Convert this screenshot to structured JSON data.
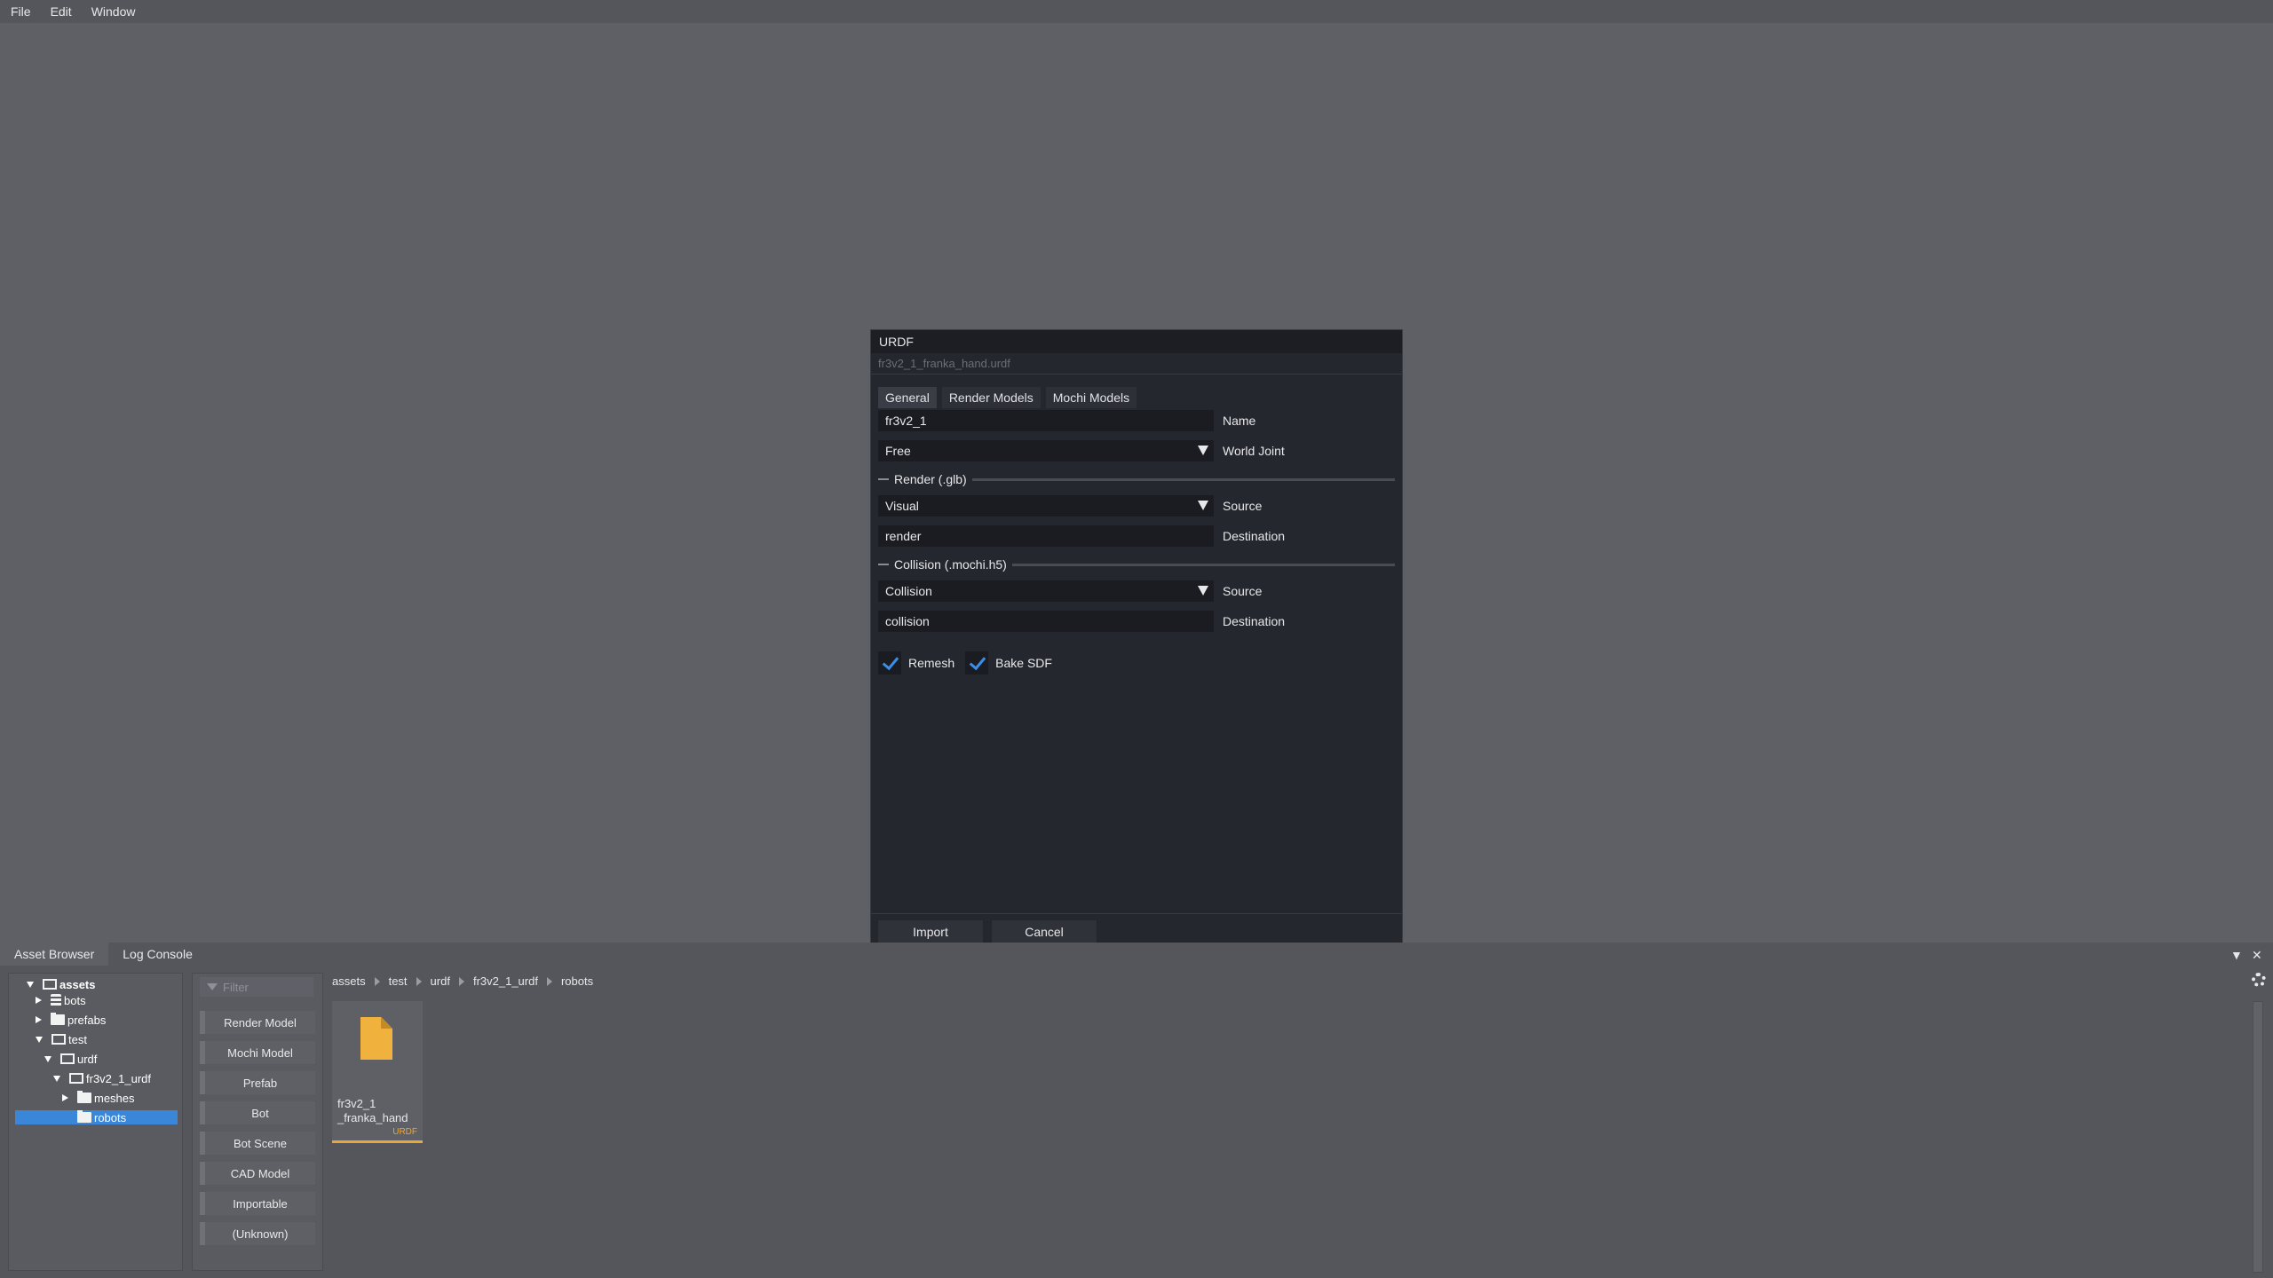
{
  "menubar": {
    "items": [
      "File",
      "Edit",
      "Window"
    ]
  },
  "dialog": {
    "title": "URDF",
    "subtitle": "fr3v2_1_franka_hand.urdf",
    "tabs": [
      "General",
      "Render Models",
      "Mochi Models"
    ],
    "name": {
      "value": "fr3v2_1",
      "label": "Name"
    },
    "world_joint": {
      "value": "Free",
      "label": "World Joint"
    },
    "render_section": "Render (.glb)",
    "render_source": {
      "value": "Visual",
      "label": "Source"
    },
    "render_dest": {
      "value": "render",
      "label": "Destination"
    },
    "collision_section": "Collision (.mochi.h5)",
    "collision_source": {
      "value": "Collision",
      "label": "Source"
    },
    "collision_dest": {
      "value": "collision",
      "label": "Destination"
    },
    "remesh": {
      "label": "Remesh",
      "checked": true
    },
    "bake_sdf": {
      "label": "Bake SDF",
      "checked": true
    },
    "import_label": "Import",
    "cancel_label": "Cancel"
  },
  "panel": {
    "tabs": [
      "Asset Browser",
      "Log Console"
    ],
    "tree": [
      {
        "label": "assets",
        "state": "open",
        "icon": "folder-open-icon"
      },
      {
        "label": "bots",
        "state": "closed",
        "icon": "database-icon"
      },
      {
        "label": "prefabs",
        "state": "closed",
        "icon": "folder-icon"
      },
      {
        "label": "test",
        "state": "open",
        "icon": "folder-open-icon"
      },
      {
        "label": "urdf",
        "state": "open",
        "icon": "folder-open-icon"
      },
      {
        "label": "fr3v2_1_urdf",
        "state": "open",
        "icon": "folder-open-icon"
      },
      {
        "label": "meshes",
        "state": "closed",
        "icon": "folder-icon"
      },
      {
        "label": "robots",
        "state": "leaf",
        "icon": "folder-icon",
        "selected": true
      }
    ],
    "filter_placeholder": "Filter",
    "types": [
      "Render Model",
      "Mochi Model",
      "Prefab",
      "Bot",
      "Bot Scene",
      "CAD Model",
      "Importable",
      "(Unknown)"
    ],
    "breadcrumb": [
      "assets",
      "test",
      "urdf",
      "fr3v2_1_urdf",
      "robots"
    ],
    "asset": {
      "name": "fr3v2_1 _franka_hand",
      "type": "URDF"
    }
  },
  "colors": {
    "accent": "#3a8ee6",
    "selection": "#3a86d8",
    "asset_highlight": "#e8a838"
  }
}
